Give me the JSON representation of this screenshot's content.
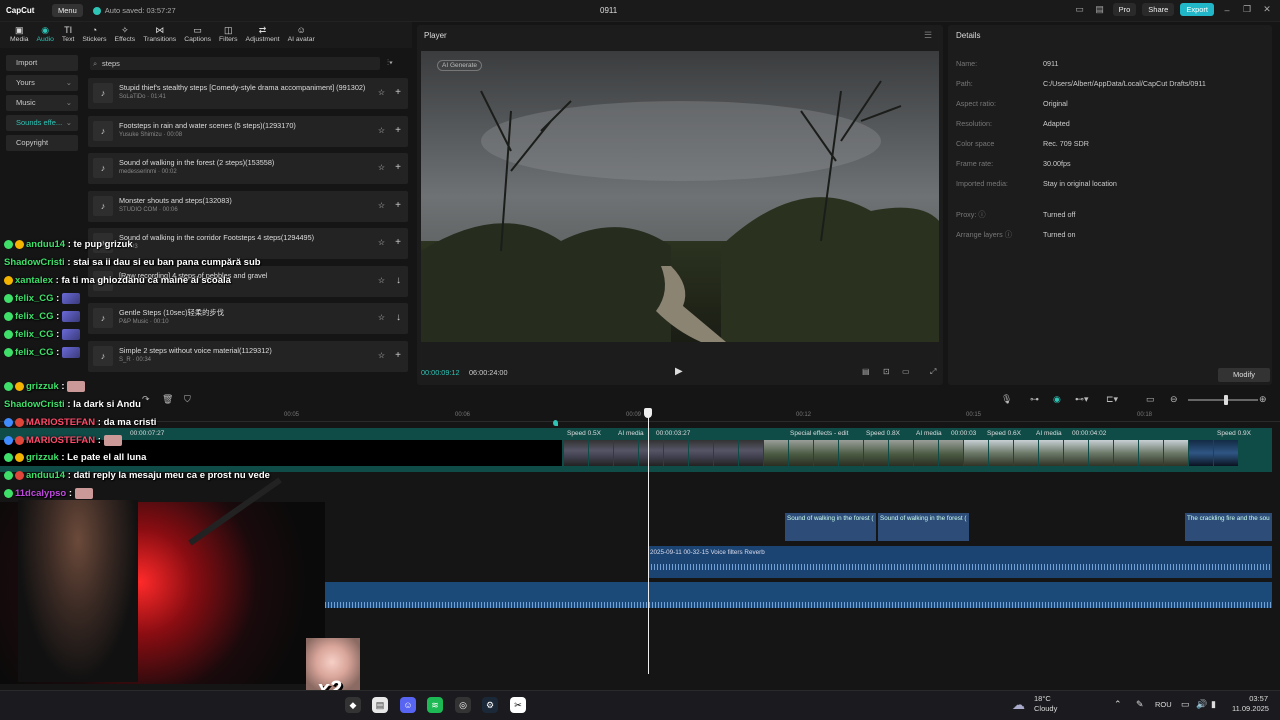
{
  "app": {
    "logo": "CapCut",
    "menu": "Menu",
    "autosave": "Auto saved: 03:57:27",
    "project_title": "0911",
    "pro": "Pro",
    "share": "Share",
    "export": "Export"
  },
  "tools": [
    "Media",
    "Audio",
    "Text",
    "Stickers",
    "Effects",
    "Transitions",
    "Captions",
    "Filters",
    "Adjustment",
    "AI avatar"
  ],
  "nav": {
    "import": "Import",
    "yours": "Yours",
    "music": "Music",
    "sounds": "Sounds effe...",
    "copyright": "Copyright"
  },
  "search": {
    "value": "steps"
  },
  "sounds": [
    {
      "title": "Stupid thief's stealthy steps [Comedy-style drama accompaniment] (991302)",
      "sub": "SoLaTiDo · 01:41"
    },
    {
      "title": "Footsteps in rain and water scenes (5 steps)(1293170)",
      "sub": "Yusuke Shimizu · 00:08"
    },
    {
      "title": "Sound of walking in the forest (2 steps)(153558)",
      "sub": "medesserinmi · 00:02"
    },
    {
      "title": "Monster shouts and steps(132083)",
      "sub": "STUDIO COM · 00:06"
    },
    {
      "title": "Sound of walking in the corridor Footsteps 4 steps(1294495)",
      "sub": "· 00:03"
    },
    {
      "title": "[Raw recording] 4 steps of pebbles and gravel",
      "sub": ""
    },
    {
      "title": "Gentle Steps (10sec)轻柔的步伐",
      "sub": "P&P Music · 00:10"
    },
    {
      "title": "Simple 2 steps without voice material(1129312)",
      "sub": "S_R · 00:34"
    }
  ],
  "player": {
    "title": "Player",
    "ai_generate": "AI Generate",
    "current": "00:00:09:12",
    "total": "06:00:24:00"
  },
  "details": {
    "title": "Details",
    "rows": [
      {
        "k": "Name:",
        "v": "0911"
      },
      {
        "k": "Path:",
        "v": "C:/Users/Albert/AppData/Local/CapCut Drafts/0911"
      },
      {
        "k": "Aspect ratio:",
        "v": "Original"
      },
      {
        "k": "Resolution:",
        "v": "Adapted"
      },
      {
        "k": "Color space",
        "v": "Rec. 709 SDR"
      },
      {
        "k": "Frame rate:",
        "v": "30.00fps"
      },
      {
        "k": "Imported media:",
        "v": "Stay in original location"
      },
      {
        "k": "Proxy: ⓘ",
        "v": "Turned off"
      },
      {
        "k": "Arrange layers ⓘ",
        "v": "Turned on"
      }
    ],
    "modify": "Modify"
  },
  "ruler": [
    "00:05",
    "00:06",
    "00:09",
    "00:12",
    "00:15",
    "00:18"
  ],
  "timeline": {
    "clip1_time": "00:00:07:27",
    "speed1": "Speed 0.5X",
    "ai1": "AI media",
    "t1": "00:00:03:27",
    "fx": "Special effects - edit",
    "speed2": "Speed 0.8X",
    "ai2": "AI media",
    "t2": "00:00:03",
    "speed3": "Speed 0.6X",
    "ai3": "AI media",
    "t3": "00:00:04:02",
    "speed4": "Speed 0.9X",
    "sfx1": "Sound of walking in the forest (",
    "sfx2": "Sound of walking in the forest (",
    "sfx3": "The crackling fire and the sou",
    "voice": "2025-09-11 00-32-15   Voice filters Reverb"
  },
  "chat": [
    {
      "user": "anduu14",
      "msg": " : te pup grizuk"
    },
    {
      "user": "ShadowCristi",
      "msg": " : stai sa ii dau si eu ban pana cumpără sub"
    },
    {
      "user": "xantalex",
      "msg": " : fa ti ma ghiozdanu ca maine ai scoala"
    },
    {
      "user": "felix_CG",
      "msg": " : "
    },
    {
      "user": "felix_CG",
      "msg": " : "
    },
    {
      "user": "felix_CG",
      "msg": " : "
    },
    {
      "user": "felix_CG",
      "msg": " : "
    },
    {
      "user": "grizzuk",
      "msg": " : "
    },
    {
      "user": "ShadowCristi",
      "msg": " : la dark si Andu"
    },
    {
      "user": "MARIOSTEFAN",
      "msg": " : da ma cristi"
    },
    {
      "user": "MARIOSTEFAN",
      "msg": " : "
    },
    {
      "user": "grizzuk",
      "msg": " : Le pate el all luna"
    },
    {
      "user": "anduu14",
      "msg": " : dati reply la mesaju meu ca e prost nu vede"
    },
    {
      "user": "11dcalypso",
      "msg": " : "
    }
  ],
  "overlay": {
    "multiplier": "x2"
  },
  "taskbar": {
    "temp": "18°C",
    "weather": "Cloudy",
    "lang": "ROU",
    "time": "03:57",
    "date": "11.09.2025"
  }
}
